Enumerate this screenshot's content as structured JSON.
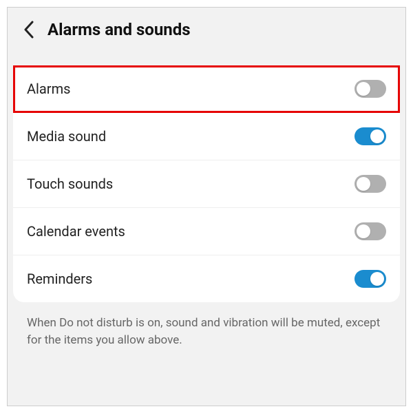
{
  "header": {
    "title": "Alarms and sounds"
  },
  "rows": [
    {
      "label": "Alarms",
      "on": false,
      "highlighted": true
    },
    {
      "label": "Media sound",
      "on": true,
      "highlighted": false
    },
    {
      "label": "Touch sounds",
      "on": false,
      "highlighted": false
    },
    {
      "label": "Calendar events",
      "on": false,
      "highlighted": false
    },
    {
      "label": "Reminders",
      "on": true,
      "highlighted": false
    }
  ],
  "footer": {
    "text": "When Do not disturb is on, sound and vibration will be muted, except for the items you allow above."
  }
}
